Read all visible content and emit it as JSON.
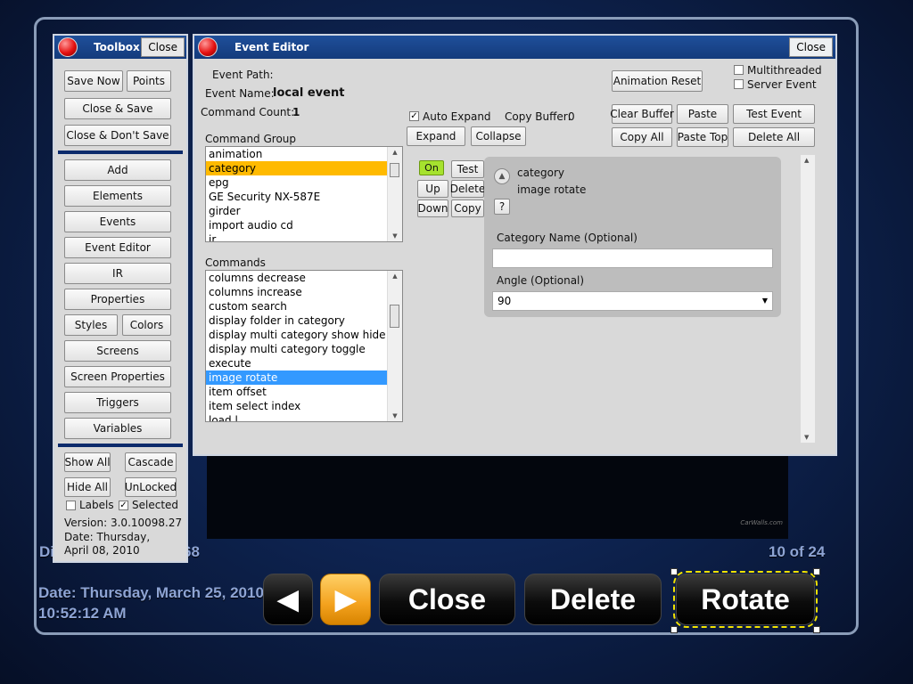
{
  "toolbox": {
    "title": "Toolbox",
    "close": "Close",
    "buttons": {
      "save_now": "Save Now",
      "points": "Points",
      "close_save": "Close & Save",
      "close_dont_save": "Close & Don't Save",
      "add": "Add",
      "elements": "Elements",
      "events": "Events",
      "event_editor": "Event Editor",
      "ir": "IR",
      "properties": "Properties",
      "styles": "Styles",
      "colors": "Colors",
      "screens": "Screens",
      "screen_properties": "Screen Properties",
      "triggers": "Triggers",
      "variables": "Variables",
      "show_all": "Show All",
      "cascade": "Cascade",
      "hide_all": "Hide All",
      "unlocked": "UnLocked"
    },
    "labels_checkbox": "Labels",
    "selected_checkbox": "Selected",
    "version": "Version: 3.0.10098.27",
    "date": "Date: Thursday, April 08, 2010"
  },
  "editor": {
    "title": "Event Editor",
    "close": "Close",
    "event_path_label": "Event Path:",
    "event_name_label": "Event Name:",
    "event_name_value": "local event",
    "command_count_label": "Command Count:",
    "command_count_value": "1",
    "auto_expand": "Auto Expand",
    "copy_buffer_label": "Copy Buffer:",
    "copy_buffer_value": "0",
    "expand": "Expand",
    "collapse": "Collapse",
    "animation_reset": "Animation Reset",
    "multithreaded": "Multithreaded",
    "server_event": "Server Event",
    "clear_buffer": "Clear Buffer",
    "paste": "Paste",
    "test_event": "Test Event",
    "copy_all": "Copy All",
    "paste_top": "Paste Top",
    "delete_all": "Delete All",
    "command_group_label": "Command Group",
    "command_groups": [
      "animation",
      "category",
      "epg",
      "GE Security NX-587E",
      "girder",
      "import audio cd",
      "ir"
    ],
    "commands_label": "Commands",
    "commands": [
      "columns decrease",
      "columns increase",
      "custom search",
      "display folder in category",
      "display multi category show hide",
      "display multi category toggle",
      "execute",
      "image rotate",
      "item offset",
      "item select index",
      "load l"
    ],
    "cmd_on": "On",
    "cmd_test": "Test",
    "cmd_up": "Up",
    "cmd_delete": "Delete",
    "cmd_down": "Down",
    "cmd_copy": "Copy",
    "command_title_1": "category",
    "command_title_2": "image rotate",
    "help": "?",
    "category_name_label": "Category Name (Optional)",
    "category_name_value": "",
    "angle_label": "Angle (Optional)",
    "angle_value": "90"
  },
  "screen": {
    "left_text_partial": "Di",
    "left_text_partial2": "68",
    "counter": "10 of 24",
    "date_line1": "Date: Thursday, March 25, 2010",
    "date_line2": "10:52:12 AM",
    "prev_arrow": "◀",
    "next_arrow": "▶",
    "close": "Close",
    "delete": "Delete",
    "rotate": "Rotate",
    "watermark": "CarWalls.com"
  },
  "colors": {
    "accent_orange": "#ffba00",
    "selection_blue": "#3399ff",
    "titlebar": "#1a4588",
    "on_green": "#a6e22e"
  }
}
